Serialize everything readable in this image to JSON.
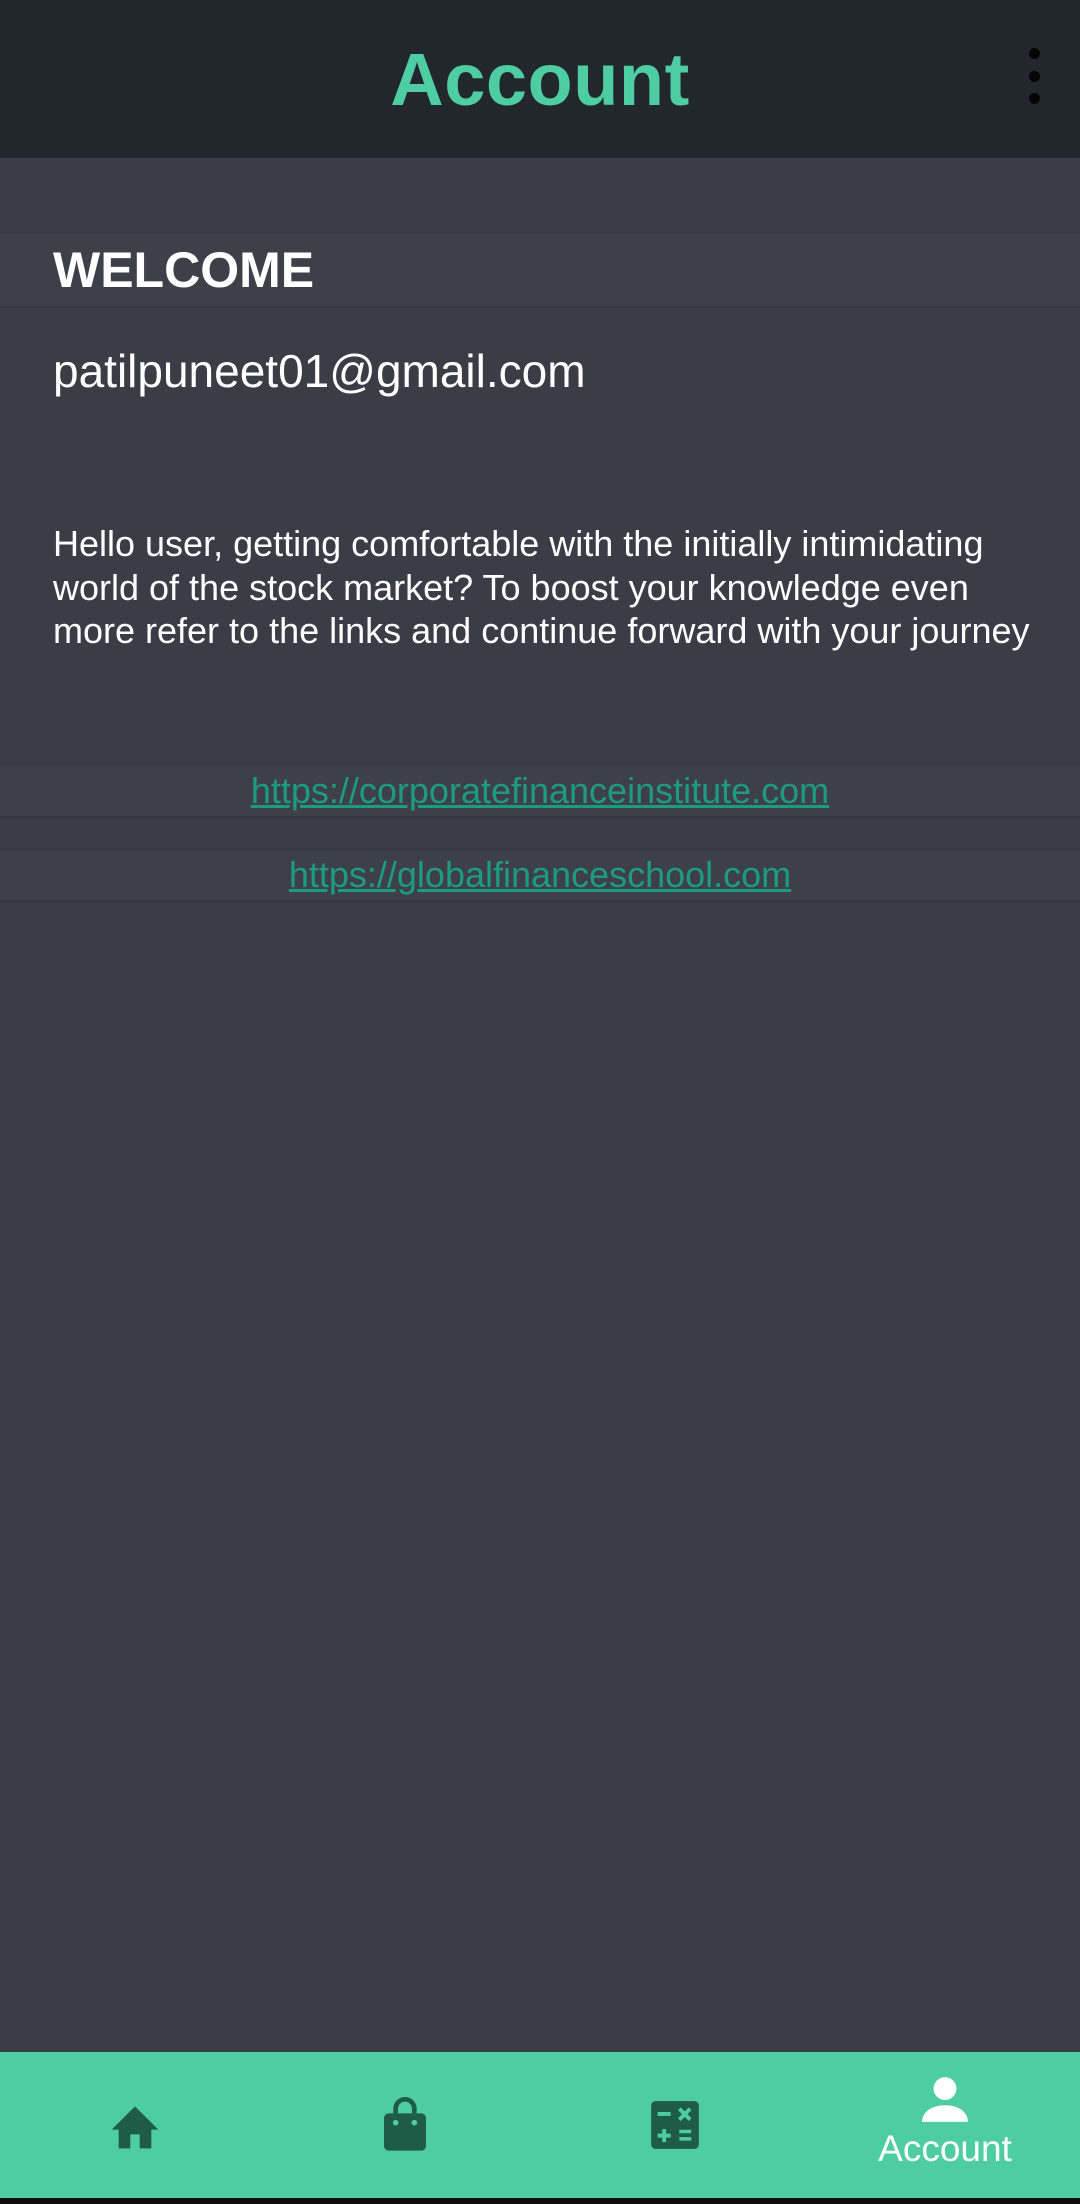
{
  "app_bar": {
    "title": "Account",
    "menu_icon": "more-vert-icon"
  },
  "welcome": {
    "heading": "WELCOME"
  },
  "user": {
    "email": "patilpuneet01@gmail.com"
  },
  "message": "Hello user, getting comfortable with the initially intimidating world of the stock market? To boost your knowledge even more refer to the links and continue forward with your journey",
  "links": [
    {
      "text": "https://corporatefinanceinstitute.com"
    },
    {
      "text": "https://globalfinanceschool.com"
    }
  ],
  "bottom_nav": {
    "items": [
      {
        "icon": "home-icon",
        "label": ""
      },
      {
        "icon": "shopping-bag-icon",
        "label": ""
      },
      {
        "icon": "calculator-icon",
        "label": ""
      },
      {
        "icon": "person-icon",
        "label": "Account",
        "active": true
      }
    ]
  },
  "colors": {
    "accent": "#4ecda3",
    "app_bar_bg": "#22262d",
    "background": "#3a3d46",
    "link": "#1d9b80",
    "inactive_icon": "#1e5c47"
  }
}
